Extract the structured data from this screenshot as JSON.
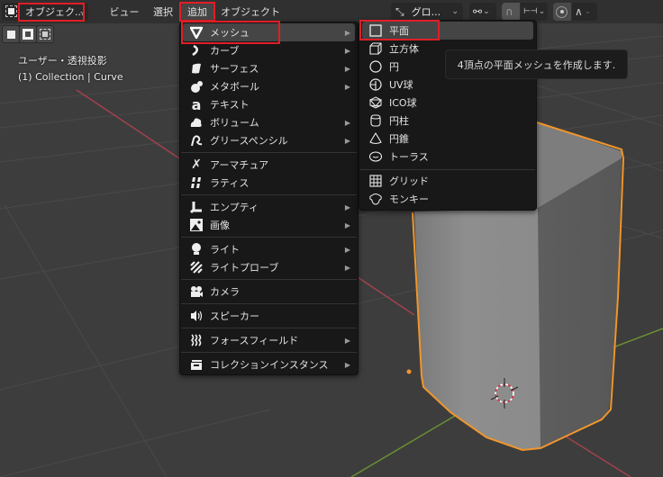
{
  "header": {
    "mode_label": "オブジェク...",
    "menus": [
      "ビュー",
      "選択",
      "追加",
      "オブジェクト"
    ],
    "active_menu": "追加",
    "transform_orientation": "グロ...",
    "icons": {
      "mode": "object-mode-icon",
      "orientation": "transform-orientation-icon",
      "pivot": "pivot-point-icon",
      "snap": "snap-magnet-icon",
      "snap_target": "snap-increment-icon",
      "proportional": "proportional-edit-icon",
      "falloff": "falloff-curve-icon"
    }
  },
  "viewport": {
    "view_name": "ユーザー・透視投影",
    "collection_info": "(1) Collection | Curve",
    "accent_selected": "#f0962c",
    "axis_x_color": "#a0424d",
    "axis_y_color": "#6c8f32"
  },
  "add_menu": {
    "items": [
      {
        "label": "メッシュ",
        "icon": "mesh-icon",
        "submenu": true,
        "highlighted": true
      },
      {
        "label": "カーブ",
        "icon": "curve-icon",
        "submenu": true
      },
      {
        "label": "サーフェス",
        "icon": "surface-icon",
        "submenu": true
      },
      {
        "label": "メタボール",
        "icon": "metaball-icon",
        "submenu": true
      },
      {
        "label": "テキスト",
        "icon": "text-icon",
        "submenu": false
      },
      {
        "label": "ボリューム",
        "icon": "volume-icon",
        "submenu": true
      },
      {
        "label": "グリースペンシル",
        "icon": "grease-pencil-icon",
        "submenu": true
      },
      {
        "label": "アーマチュア",
        "icon": "armature-icon",
        "submenu": false
      },
      {
        "label": "ラティス",
        "icon": "lattice-icon",
        "submenu": false
      },
      {
        "label": "エンプティ",
        "icon": "empty-icon",
        "submenu": true
      },
      {
        "label": "画像",
        "icon": "image-icon",
        "submenu": true
      },
      {
        "label": "ライト",
        "icon": "light-icon",
        "submenu": true
      },
      {
        "label": "ライトプローブ",
        "icon": "light-probe-icon",
        "submenu": true
      },
      {
        "label": "カメラ",
        "icon": "camera-icon",
        "submenu": false
      },
      {
        "label": "スピーカー",
        "icon": "speaker-icon",
        "submenu": false
      },
      {
        "label": "フォースフィールド",
        "icon": "force-field-icon",
        "submenu": true
      },
      {
        "label": "コレクションインスタンス",
        "icon": "collection-instance-icon",
        "submenu": true
      }
    ]
  },
  "mesh_menu": {
    "items": [
      {
        "label": "平面",
        "icon": "plane-icon",
        "highlighted": true
      },
      {
        "label": "立方体",
        "icon": "cube-icon"
      },
      {
        "label": "円",
        "icon": "circle-icon"
      },
      {
        "label": "UV球",
        "icon": "uv-sphere-icon"
      },
      {
        "label": "ICO球",
        "icon": "ico-sphere-icon"
      },
      {
        "label": "円柱",
        "icon": "cylinder-icon"
      },
      {
        "label": "円錐",
        "icon": "cone-icon"
      },
      {
        "label": "トーラス",
        "icon": "torus-icon"
      },
      {
        "label": "グリッド",
        "icon": "grid-icon"
      },
      {
        "label": "モンキー",
        "icon": "monkey-icon"
      }
    ]
  },
  "tooltip": {
    "text": "4頂点の平面メッシュを作成します."
  },
  "annotation_color": "#e01e26"
}
